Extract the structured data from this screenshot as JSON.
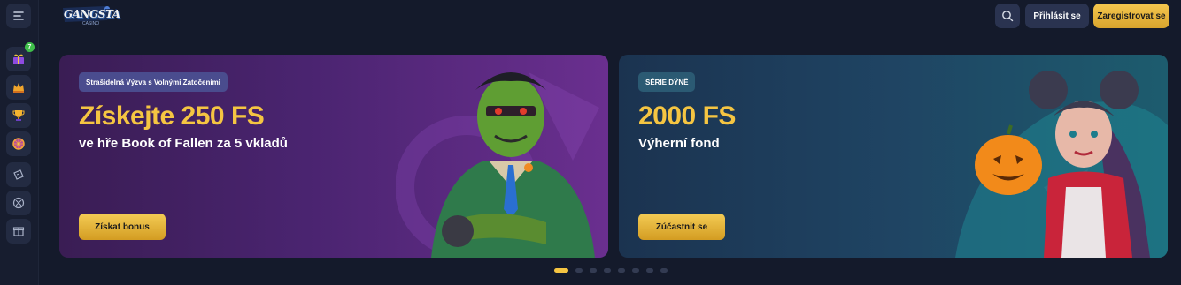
{
  "header": {
    "logo_text": "GANGSTA",
    "logo_sub": "CASINO",
    "login_label": "Přihlásit se",
    "register_label": "Zaregistrovat se"
  },
  "sidebar": {
    "badge_count": "7"
  },
  "banners": [
    {
      "tag": "Strašidelná Výzva s Volnými Zatočeními",
      "headline": "Získejte 250 FS",
      "subline": "ve hře Book of Fallen za 5 vkladů",
      "cta": "Získat bonus"
    },
    {
      "tag": "SÉRIE DÝNĚ",
      "headline": "2000 FS",
      "subline": "Výherní fond",
      "cta": "Zúčastnit se"
    }
  ],
  "carousel": {
    "active_index": 0,
    "total": 8
  },
  "colors": {
    "accent_gold": "#f5c542",
    "background": "#141a2b"
  }
}
